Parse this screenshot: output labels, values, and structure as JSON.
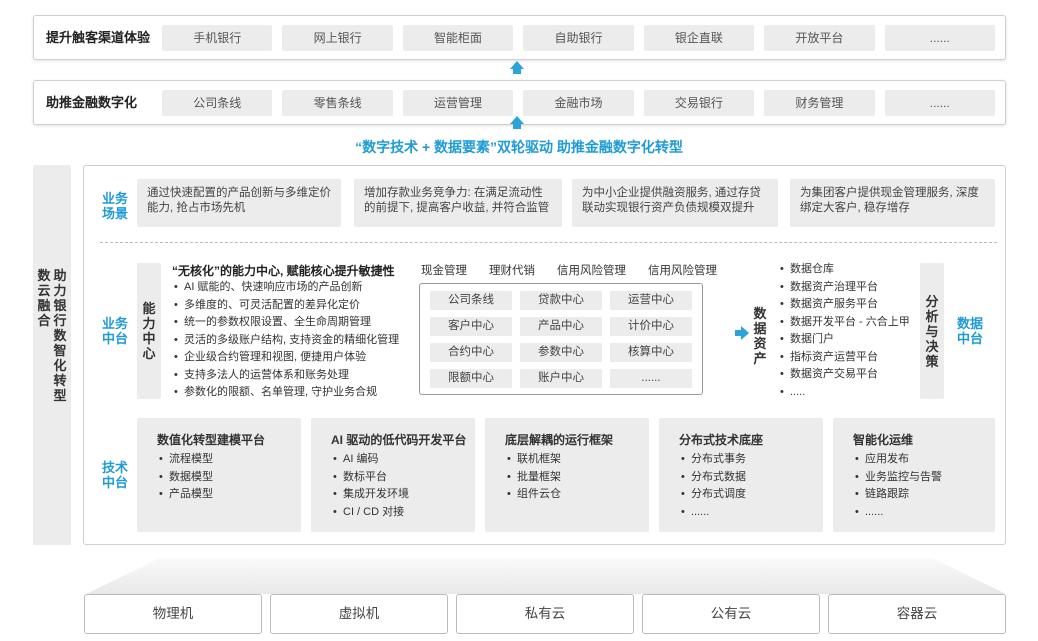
{
  "channel": {
    "label": "提升触客渠道体验",
    "items": [
      "手机银行",
      "网上银行",
      "智能柜面",
      "自助银行",
      "银企直联",
      "开放平台",
      "......"
    ]
  },
  "finance": {
    "label": "助推金融数字化",
    "items": [
      "公司条线",
      "零售条线",
      "运营管理",
      "金融市场",
      "交易银行",
      "财务管理",
      "......"
    ]
  },
  "slogan": "“数字技术 + 数据要素”双轮驱动  助推金融数字化转型",
  "side_title_1": [
    "数",
    "云",
    "融",
    "合"
  ],
  "side_title_2": [
    "助",
    "力",
    "银",
    "行",
    "数",
    "智",
    "化",
    "转",
    "型"
  ],
  "scene": {
    "label": [
      "业务",
      "场景"
    ],
    "cards": [
      [
        "通过快速配置的产品创新与多维定价",
        "能力, 抢占市场先机"
      ],
      [
        "增加存款业务竞争力: 在满足流动性",
        "的前提下, 提高客户收益, 并符合监管"
      ],
      [
        "为中小企业提供融资服务, 通过存贷",
        "联动实现银行资产负债规模双提升"
      ],
      [
        "为集团客户提供现金管理服务, 深度",
        "绑定大客户, 稳存增存"
      ]
    ]
  },
  "business": {
    "label": [
      "业务",
      "中台"
    ],
    "capability_label": [
      "能",
      "力",
      "中",
      "心"
    ],
    "capability_title": "“无核化”的能力中心, 赋能核心提升敏捷性",
    "capability_points": [
      "AI 赋能的、快速响应市场的产品创新",
      "多维度的、可灵活配置的差异化定价",
      "统一的参数权限设置、全生命周期管理",
      "灵活的多级账户结构, 支持资金的精细化管理",
      "企业级合约管理和视图, 便捷用户体验",
      "支持多法人的运营体系和账务处理",
      "参数化的限额、名单管理, 守护业务合规"
    ],
    "mgmt": [
      "现金管理",
      "理财代销",
      "信用风险管理",
      "信用风险管理"
    ],
    "centers": [
      [
        "公司条线",
        "贷款中心",
        "运营中心"
      ],
      [
        "客户中心",
        "产品中心",
        "计价中心"
      ],
      [
        "合约中心",
        "参数中心",
        "核算中心"
      ],
      [
        "限额中心",
        "账户中心",
        "......"
      ]
    ],
    "data_asset_label": [
      "数",
      "据",
      "资",
      "产"
    ],
    "data_points": [
      "数据仓库",
      "数据资产治理平台",
      "数据资产服务平台",
      "数据开发平台 - 六合上甲",
      "数据门户",
      "指标资产运营平台",
      "数据资产交易平台",
      "....."
    ],
    "analysis_label": [
      "分",
      "析",
      "与",
      "决",
      "策"
    ],
    "data_center_label": [
      "数据",
      "中台"
    ]
  },
  "tech": {
    "label": [
      "技术",
      "中台"
    ],
    "cards": [
      {
        "title": "数值化转型建模平台",
        "points": [
          "流程模型",
          "数据模型",
          "产品模型"
        ]
      },
      {
        "title": "AI 驱动的低代码开发平台",
        "points": [
          "AI 编码",
          "数标平台",
          "集成开发环境",
          "CI / CD 对接"
        ]
      },
      {
        "title": "底层解耦的运行框架",
        "points": [
          "联机框架",
          "批量框架",
          "组件云仓"
        ]
      },
      {
        "title": "分布式技术底座",
        "points": [
          "分布式事务",
          "分布式数据",
          "分布式调度",
          "......"
        ]
      },
      {
        "title": "智能化运维",
        "points": [
          "应用发布",
          "业务监控与告警",
          "链路跟踪",
          "......"
        ]
      }
    ]
  },
  "infra": [
    "物理机",
    "虚拟机",
    "私有云",
    "公有云",
    "容器云"
  ],
  "colors": {
    "accent": "#1f9bd7",
    "chip": "#ececec",
    "border": "#cfcfcf"
  }
}
